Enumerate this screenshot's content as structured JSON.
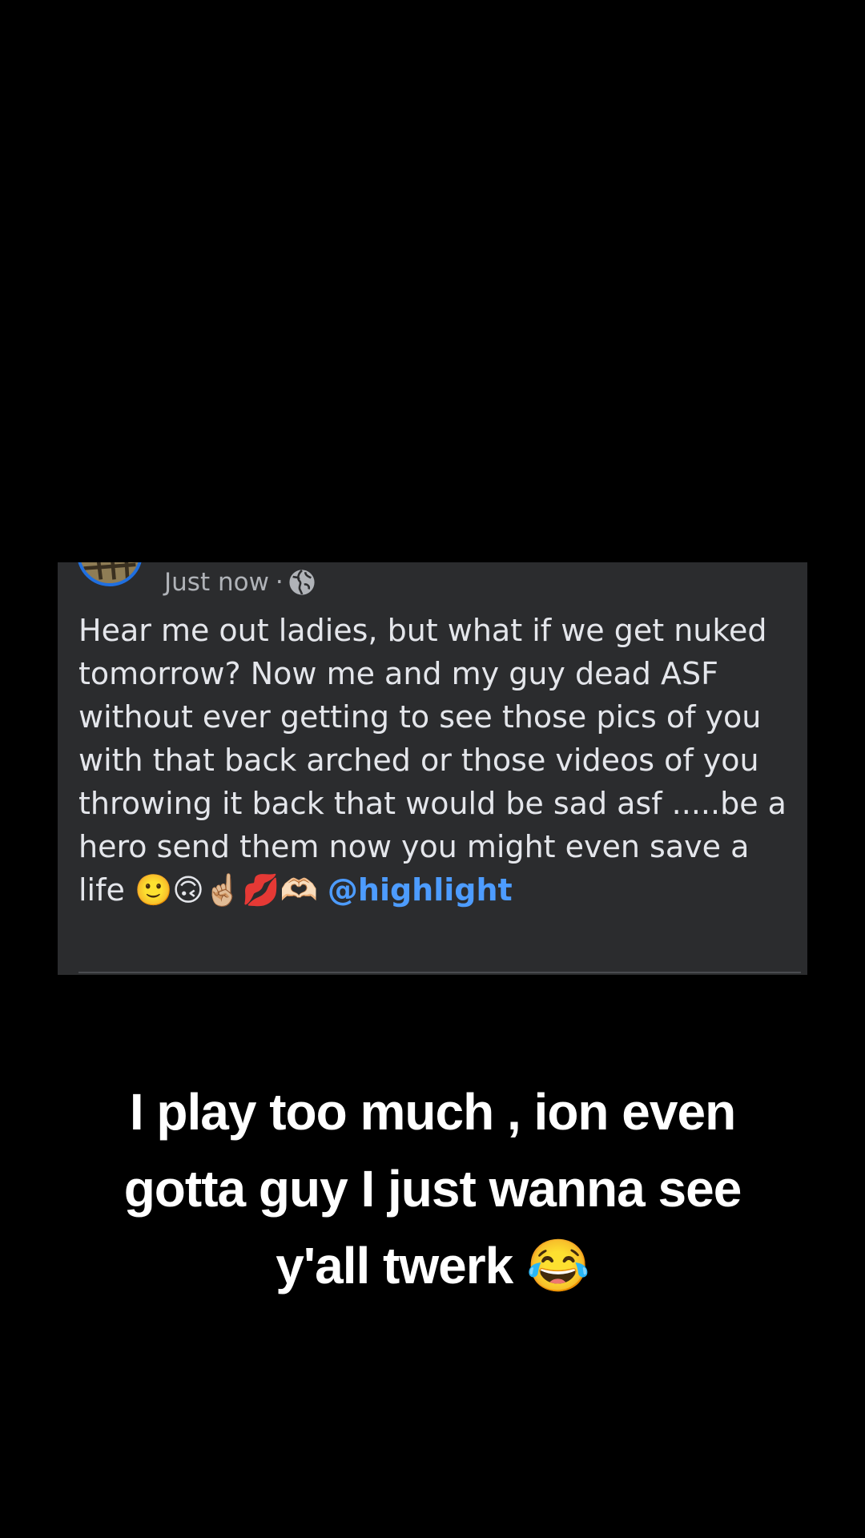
{
  "post": {
    "timestamp": "Just now",
    "separator": "·",
    "privacy_icon": "globe-icon",
    "body_text": "Hear me out ladies, but what if we get nuked tomorrow? Now me and my guy dead ASF without ever getting to see those pics of you with that back arched or those videos of you throwing it back that would be sad asf .....be a hero send them now you might even save a life 🙂🙃☝🏼💋🫶🏻 ",
    "mention": "@highlight"
  },
  "caption": {
    "text": "I play too much , ion even\ngotta guy I just wanna see\ny'all twerk 😂"
  },
  "colors": {
    "background": "#000000",
    "card": "#2b2c2e",
    "body_text": "#e4e6eb",
    "meta_text": "#b0b3b8",
    "mention": "#4d9cff",
    "avatar_ring": "#1f6fe0"
  }
}
